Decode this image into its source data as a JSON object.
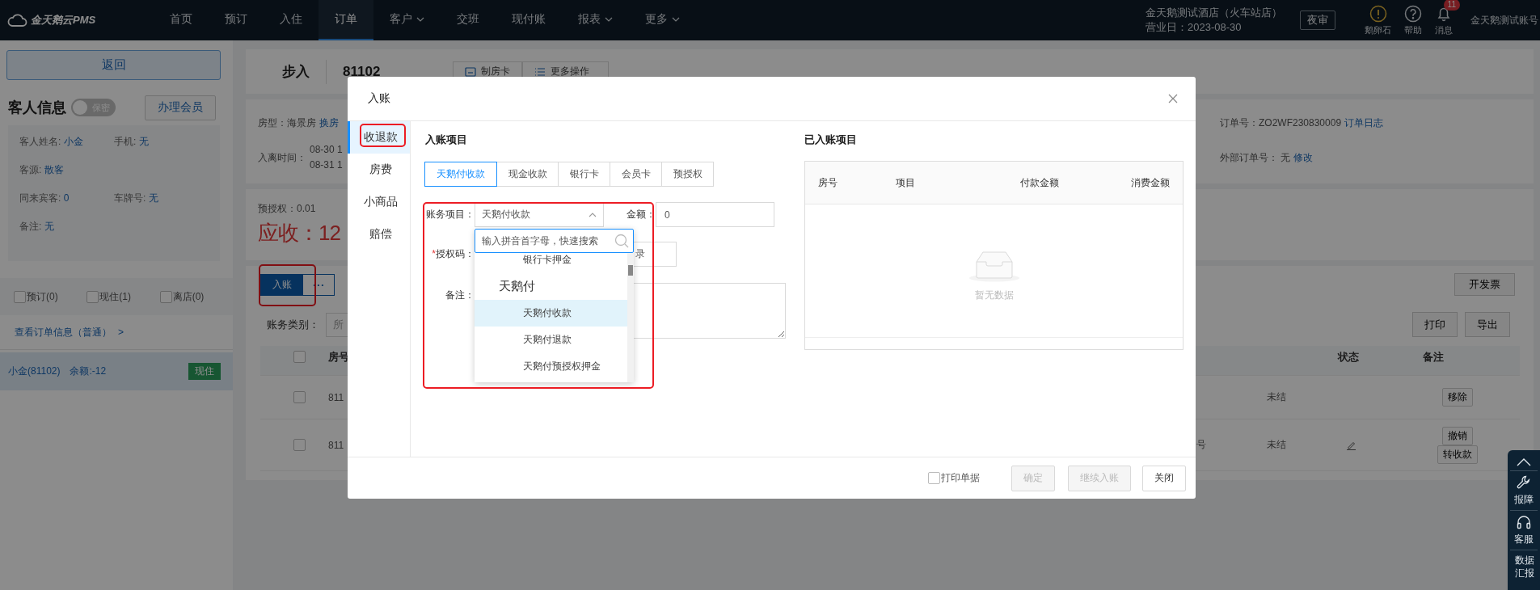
{
  "nav": {
    "logo": "金天鹅云PMS",
    "items": [
      {
        "label": "首页",
        "selected": false,
        "has_menu": false
      },
      {
        "label": "预订",
        "selected": false,
        "has_menu": false
      },
      {
        "label": "入住",
        "selected": false,
        "has_menu": false
      },
      {
        "label": "订单",
        "selected": true,
        "has_menu": false
      },
      {
        "label": "客户",
        "selected": false,
        "has_menu": true
      },
      {
        "label": "交班",
        "selected": false,
        "has_menu": false
      },
      {
        "label": "现付账",
        "selected": false,
        "has_menu": false
      },
      {
        "label": "报表",
        "selected": false,
        "has_menu": true
      },
      {
        "label": "更多",
        "selected": false,
        "has_menu": true
      }
    ],
    "hotel": "金天鹅测试酒店（火车站店）",
    "business_day": "营业日：2023-08-30",
    "night_audit": "夜审",
    "tools": [
      {
        "kind": "alert",
        "label": "鹅卵石"
      },
      {
        "kind": "help",
        "label": "帮助"
      },
      {
        "kind": "bell",
        "label": "消息",
        "badge": "11"
      }
    ],
    "account": "金天鹅测试账号"
  },
  "left": {
    "back": "返回",
    "guest_title": "客人信息",
    "privacy_toggle": {
      "label": "保密",
      "on": false
    },
    "member_button": "办理会员",
    "fields": [
      [
        {
          "label": "客人姓名:",
          "value": "小金"
        },
        {
          "label": "手机:",
          "value": "无"
        }
      ],
      [
        {
          "label": "客源:",
          "value": "散客"
        }
      ],
      [
        {
          "label": "同来宾客:",
          "value": "0"
        },
        {
          "label": "车牌号:",
          "value": "无"
        }
      ],
      [
        {
          "label": "备注:",
          "value": "无"
        }
      ]
    ],
    "filters": [
      {
        "label": "预订(0)",
        "checked": false
      },
      {
        "label": "现住(1)",
        "checked": false
      },
      {
        "label": "离店(0)",
        "checked": false
      }
    ],
    "order_link": "查看订单信息（普通）",
    "order_link_arrow": ">",
    "guests": [
      {
        "name": "小金(81102)",
        "balance": "余额:-12",
        "status": "现住",
        "selected": true
      }
    ]
  },
  "header": {
    "title": "步入",
    "room": "81102",
    "buttons": [
      {
        "kind": "card",
        "label": "制房卡"
      },
      {
        "kind": "list",
        "label": "更多操作"
      }
    ]
  },
  "info": {
    "room_type": {
      "label": "房型：",
      "value": "海景房",
      "link": "换房"
    },
    "stay": {
      "label": "入离时间：",
      "times": [
        "08-30 1",
        "08-31 1"
      ]
    },
    "order_no": {
      "label": "订单号：",
      "value": "ZO2WF230830009",
      "link": "订单日志"
    },
    "external": {
      "label": "外部订单号：",
      "value": "无",
      "link": "修改"
    }
  },
  "balance": {
    "preauth": "预授权：0.01",
    "receivable": "应收：12"
  },
  "bills": {
    "post_button": "入账",
    "more_button": "• • •",
    "highlighted": true,
    "invoice": "开发票",
    "category_label": "账务类别：",
    "category_value": "所",
    "print": "打印",
    "export": "导出",
    "select_all_checked": false,
    "columns": {
      "room": "房号",
      "status": "状态",
      "remark": "备注"
    },
    "rows": [
      {
        "checked": false,
        "room": "811",
        "status": "未结",
        "remark_icon": false,
        "actions": [
          "移除"
        ]
      },
      {
        "checked": false,
        "room": "811",
        "column_3": "号",
        "status": "未结",
        "remark_icon": true,
        "actions": [
          "撤销",
          "转收款"
        ]
      }
    ]
  },
  "modal": {
    "title": "入账",
    "side_tabs": [
      {
        "label": "收退款",
        "selected": true,
        "highlighted": true
      },
      {
        "label": "房费",
        "selected": false,
        "highlighted": false
      },
      {
        "label": "小商品",
        "selected": false,
        "highlighted": false
      },
      {
        "label": "赔偿",
        "selected": false,
        "highlighted": false
      }
    ],
    "section_title": "入账项目",
    "pay_tabs": [
      {
        "label": "天鹅付收款",
        "selected": true
      },
      {
        "label": "现金收款",
        "selected": false
      },
      {
        "label": "银行卡",
        "selected": false
      },
      {
        "label": "会员卡",
        "selected": false
      },
      {
        "label": "预授权",
        "selected": false
      }
    ],
    "form": {
      "highlighted": true,
      "item_label": "账务项目：",
      "item_value": "天鹅付收款",
      "expanded": true,
      "amount_label": "金额：",
      "amount_value": "0",
      "auth_label": "授权码：",
      "auth_required_mark": "*",
      "auth_button": "录",
      "remark_label": "备注："
    },
    "dropdown": {
      "placeholder": "输入拼音首字母，快速搜索",
      "options": [
        {
          "kind": "option",
          "label": "银行卡押金",
          "selected": false
        },
        {
          "kind": "group",
          "label": "天鹅付"
        },
        {
          "kind": "option",
          "label": "天鹅付收款",
          "selected": true
        },
        {
          "kind": "option",
          "label": "天鹅付退款",
          "selected": false
        },
        {
          "kind": "option",
          "label": "天鹅付预授权押金",
          "selected": false
        }
      ]
    },
    "posted": {
      "title": "已入账项目",
      "columns": [
        "房号",
        "项目",
        "付款金额",
        "消费金额"
      ],
      "empty": "暂无数据"
    },
    "footer": {
      "print_receipt": {
        "label": "打印单据",
        "checked": false
      },
      "buttons": [
        {
          "label": "确定",
          "disabled": true
        },
        {
          "label": "继续入账",
          "disabled": true
        },
        {
          "label": "关闭",
          "disabled": false
        }
      ]
    }
  },
  "float_bar": [
    {
      "kind": "up"
    },
    {
      "kind": "wrench",
      "label": "报障"
    },
    {
      "kind": "headset",
      "label": "客服"
    },
    {
      "kind": "text",
      "label": "数据汇报"
    }
  ]
}
